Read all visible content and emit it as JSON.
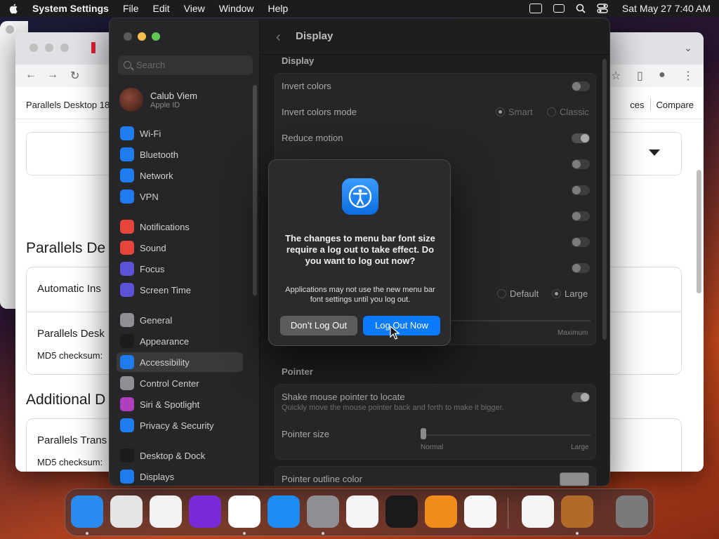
{
  "menubar": {
    "app_name": "System Settings",
    "menus": [
      "File",
      "Edit",
      "View",
      "Window",
      "Help"
    ],
    "clock": "Sat May 27  7:40 AM",
    "status_icons": [
      "battery-icon",
      "display-icon",
      "search-icon",
      "control-center-icon"
    ]
  },
  "browser": {
    "bookmark_left": "Parallels Desktop 18",
    "bookmark_right_1": "ces",
    "bookmark_right_2": "Compare",
    "heading_1": "Parallels De",
    "card1_row": "Automatic Ins",
    "card2_row1": "Parallels Desk",
    "card2_row2": "MD5 checksum:",
    "heading_2": "Additional D",
    "card3_row1": "Parallels Trans",
    "card3_row2": "MD5 checksum:"
  },
  "settings": {
    "search_placeholder": "Search",
    "account": {
      "name": "Calub Viem",
      "sub": "Apple ID"
    },
    "sidebar": [
      {
        "label": "Wi-Fi",
        "icon": "wifi-icon",
        "color": "#1f7cf0"
      },
      {
        "label": "Bluetooth",
        "icon": "bluetooth-icon",
        "color": "#1f7cf0"
      },
      {
        "label": "Network",
        "icon": "globe-icon",
        "color": "#1f7cf0"
      },
      {
        "label": "VPN",
        "icon": "vpn-icon",
        "color": "#1f7cf0"
      },
      {
        "label": "Notifications",
        "icon": "bell-icon",
        "color": "#e5453b"
      },
      {
        "label": "Sound",
        "icon": "speaker-icon",
        "color": "#e5453b"
      },
      {
        "label": "Focus",
        "icon": "moon-icon",
        "color": "#5b52d6"
      },
      {
        "label": "Screen Time",
        "icon": "hourglass-icon",
        "color": "#5b52d6"
      },
      {
        "label": "General",
        "icon": "gear-icon",
        "color": "#8e8e93"
      },
      {
        "label": "Appearance",
        "icon": "appearance-icon",
        "color": "#1c1c1e"
      },
      {
        "label": "Accessibility",
        "icon": "accessibility-icon",
        "color": "#1f7cf0"
      },
      {
        "label": "Control Center",
        "icon": "control-center-icon",
        "color": "#8e8e93"
      },
      {
        "label": "Siri & Spotlight",
        "icon": "siri-icon",
        "color": "#b03fbf"
      },
      {
        "label": "Privacy & Security",
        "icon": "hand-icon",
        "color": "#1f7cf0"
      },
      {
        "label": "Desktop & Dock",
        "icon": "dock-icon",
        "color": "#1c1c1e"
      },
      {
        "label": "Displays",
        "icon": "sun-icon",
        "color": "#1f7cf0"
      }
    ],
    "selected": "Accessibility",
    "title": "Display",
    "section_display": "Display",
    "rows": {
      "invert_colors": "Invert colors",
      "invert_mode": "Invert colors mode",
      "invert_mode_options": [
        "Smart",
        "Classic"
      ],
      "reduce_motion": "Reduce motion",
      "menu_bar_size_options": [
        "Default",
        "Large"
      ],
      "slider_max": "Maximum"
    },
    "section_pointer": "Pointer",
    "pointer": {
      "shake": "Shake mouse pointer to locate",
      "shake_sub": "Quickly move the mouse pointer back and forth to make it bigger.",
      "size": "Pointer size",
      "size_min": "Normal",
      "size_max": "Large",
      "outline": "Pointer outline color"
    }
  },
  "dialog": {
    "title": "The changes to menu bar font size require a log out to take effect. Do you want to log out now?",
    "message": "Applications may not use the new menu bar font settings until you log out.",
    "cancel_label": "Don’t Log Out",
    "confirm_label": "Log Out Now"
  },
  "dock": [
    {
      "name": "finder-icon",
      "color": "#2b8cf0",
      "running": true
    },
    {
      "name": "launchpad-icon",
      "color": "#e4e4e4",
      "running": false
    },
    {
      "name": "safari-icon",
      "color": "#f2f2f2",
      "running": false
    },
    {
      "name": "firefox-icon",
      "color": "#7a2ad6",
      "running": false
    },
    {
      "name": "chrome-icon",
      "color": "#ffffff",
      "running": true
    },
    {
      "name": "app-store-icon",
      "color": "#1c8cf2",
      "running": false
    },
    {
      "name": "system-settings-icon",
      "color": "#8e8e93",
      "running": true
    },
    {
      "name": "textedit-icon",
      "color": "#f4f4f4",
      "running": false
    },
    {
      "name": "terminal-icon",
      "color": "#1a1a1a",
      "running": false
    },
    {
      "name": "garageband-icon",
      "color": "#f08c1c",
      "running": false
    },
    {
      "name": "vscode-icon",
      "color": "#f7f7f7",
      "running": false
    },
    {
      "name": "visual-studio-icon",
      "color": "#f4f4f4",
      "running": false
    },
    {
      "name": "installer-icon",
      "color": "#b06a2a",
      "running": true
    },
    {
      "name": "trash-icon",
      "color": "#7a7a7a",
      "running": false
    }
  ]
}
